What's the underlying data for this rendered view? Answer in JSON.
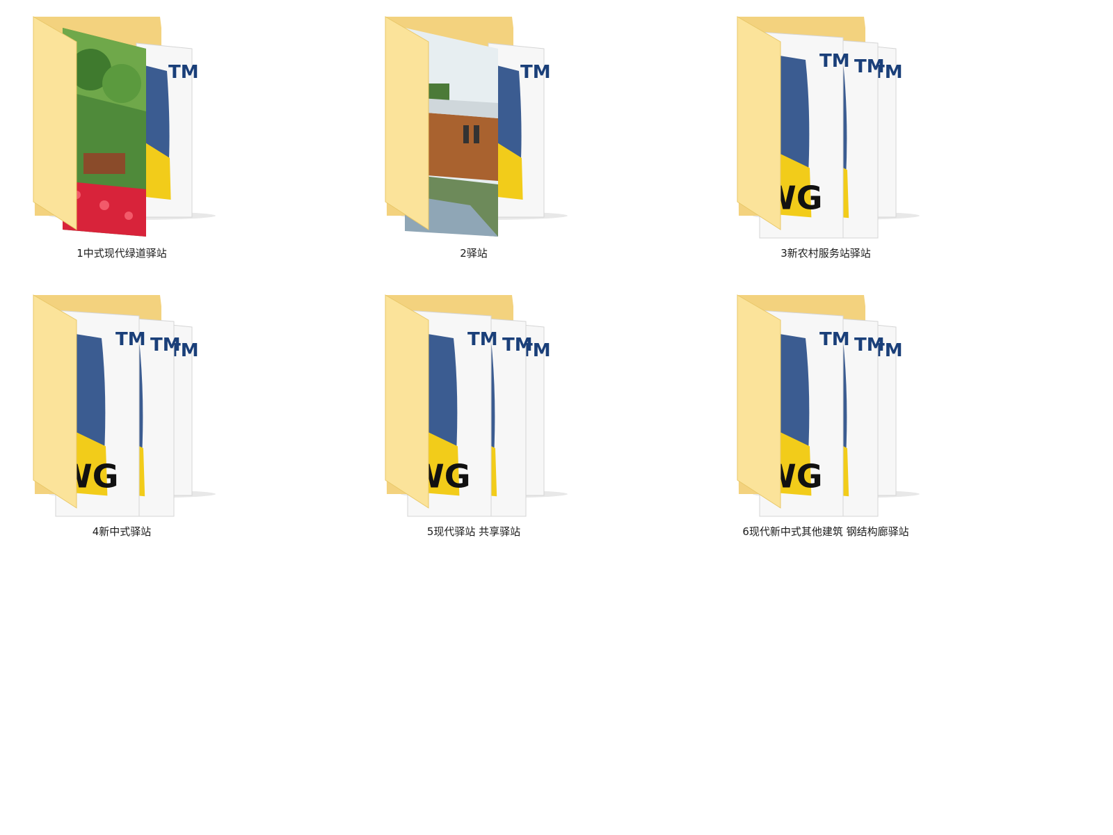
{
  "folders": [
    {
      "label": "1中式现代绿道驿站",
      "preview": "photo-garden",
      "icon": "folder-icon"
    },
    {
      "label": "2驿站",
      "preview": "photo-building",
      "icon": "folder-icon"
    },
    {
      "label": "3新农村服务站驿站",
      "preview": "dwg-files",
      "icon": "folder-icon"
    },
    {
      "label": "4新中式驿站",
      "preview": "dwg-files",
      "icon": "folder-icon"
    },
    {
      "label": "5现代驿站 共享驿站",
      "preview": "dwg-files",
      "icon": "folder-icon"
    },
    {
      "label": "6现代新中式其他建筑 钢结构廊驿站",
      "preview": "dwg-files",
      "icon": "folder-icon"
    }
  ],
  "file_mark": "TM",
  "file_type_text": "WG",
  "colors": {
    "folder_front": "#fbe39a",
    "folder_back": "#f3d27e",
    "doc_blue": "#3b5c91",
    "doc_yellow": "#f2cc1a",
    "tm_blue": "#1a3f79"
  }
}
